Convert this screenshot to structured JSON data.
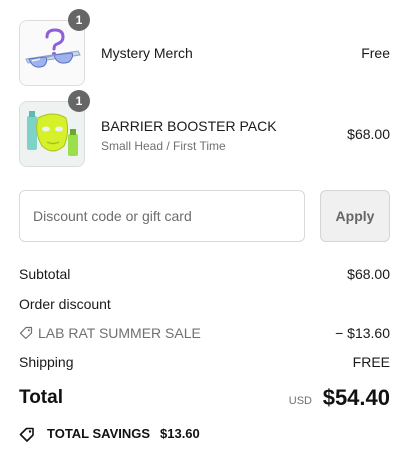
{
  "items": [
    {
      "name": "Mystery Merch",
      "variant": "",
      "price": "Free",
      "quantity": "1",
      "image_icon": "mystery-sunglasses-image"
    },
    {
      "name": "BARRIER BOOSTER PACK",
      "variant": "Small Head / First Time",
      "price": "$68.00",
      "quantity": "1",
      "image_icon": "face-mask-product-image"
    }
  ],
  "discount": {
    "placeholder": "Discount code or gift card",
    "value": "",
    "apply_label": "Apply"
  },
  "summary": {
    "subtotal_label": "Subtotal",
    "subtotal_value": "$68.00",
    "order_discount_label": "Order discount",
    "code_icon": "tag-icon",
    "code_name": "LAB RAT SUMMER SALE",
    "code_value": "− $13.60",
    "shipping_label": "Shipping",
    "shipping_value": "FREE"
  },
  "total": {
    "label": "Total",
    "currency": "USD",
    "amount": "$54.40"
  },
  "savings": {
    "icon": "tag-icon",
    "label": "TOTAL SAVINGS",
    "amount": "$13.60"
  },
  "colors": {
    "badge": "#666666",
    "muted_text": "#707070",
    "border": "#d9d9d9",
    "apply_bg": "#f0f0f0"
  }
}
